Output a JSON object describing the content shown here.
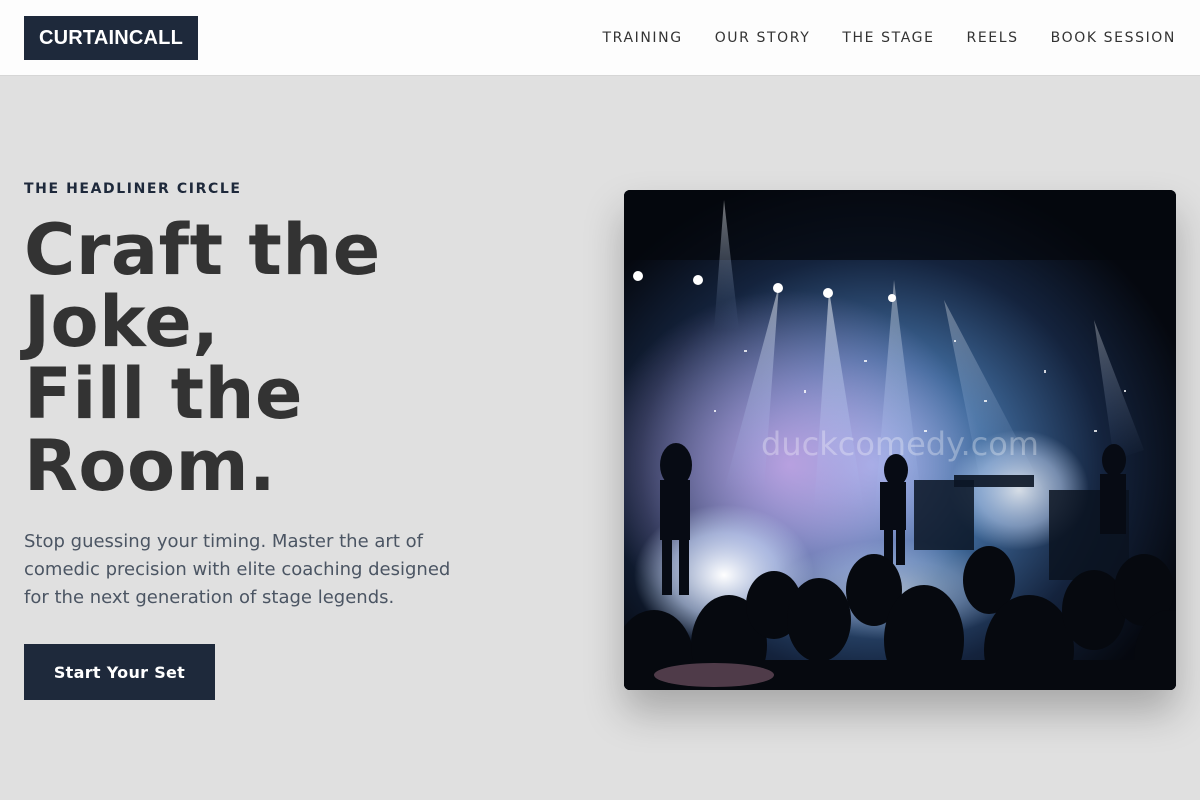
{
  "brand": {
    "logo_text": "CURTAINCALL"
  },
  "nav": {
    "items": [
      {
        "label": "TRAINING"
      },
      {
        "label": "OUR STORY"
      },
      {
        "label": "THE STAGE"
      },
      {
        "label": "REELS"
      },
      {
        "label": "BOOK SESSION"
      }
    ]
  },
  "hero": {
    "eyebrow": "THE HEADLINER CIRCLE",
    "headline_lines": [
      "Craft the",
      "Joke,",
      "Fill the",
      "Room."
    ],
    "subtext": "Stop guessing your timing. Master the art of comedic precision with elite coaching designed for the next generation of stage legends.",
    "cta_label": "Start Your Set",
    "image_watermark": "duckcomedy.com"
  },
  "colors": {
    "brand_dark": "#1e293b",
    "page_background": "#e0e0e0",
    "navbar_background": "#fdfdfd",
    "body_text": "#4b5563"
  },
  "icons": {
    "hero_image": "concert-stage-photo"
  }
}
